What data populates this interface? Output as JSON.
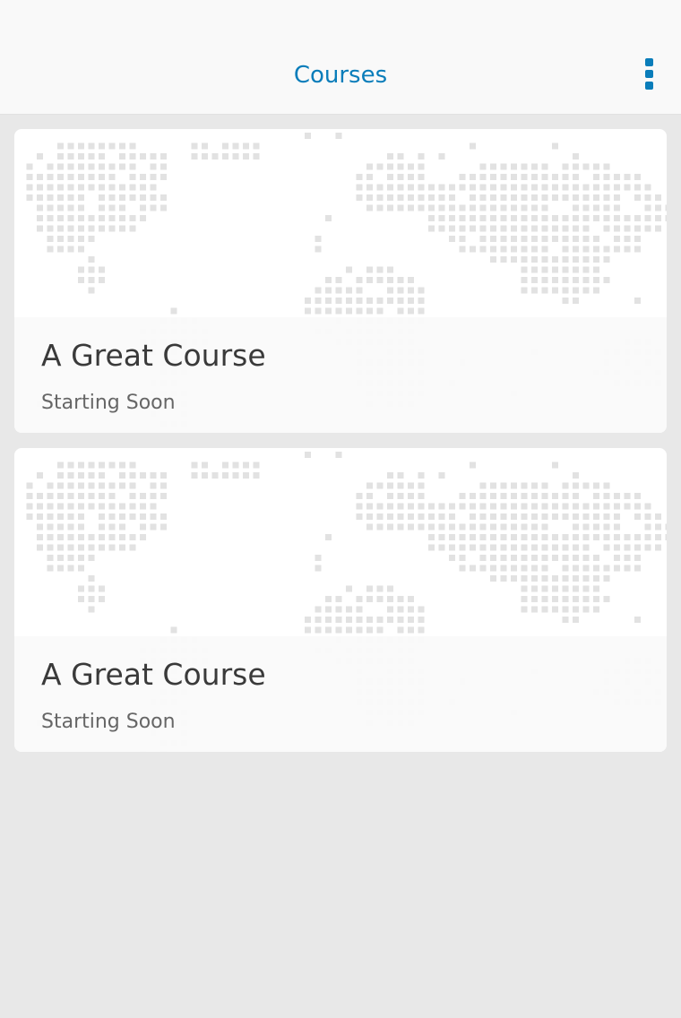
{
  "header": {
    "title": "Courses",
    "menu_icon": "more-vertical-icon"
  },
  "courses": [
    {
      "title": "A Great Course",
      "status": "Starting Soon",
      "background_icon": "world-map-dots"
    },
    {
      "title": "A Great Course",
      "status": "Starting Soon",
      "background_icon": "world-map-dots"
    }
  ],
  "colors": {
    "accent": "#0a7dba",
    "background": "#e8e8e8",
    "map_dots": "#e2e2e2"
  }
}
